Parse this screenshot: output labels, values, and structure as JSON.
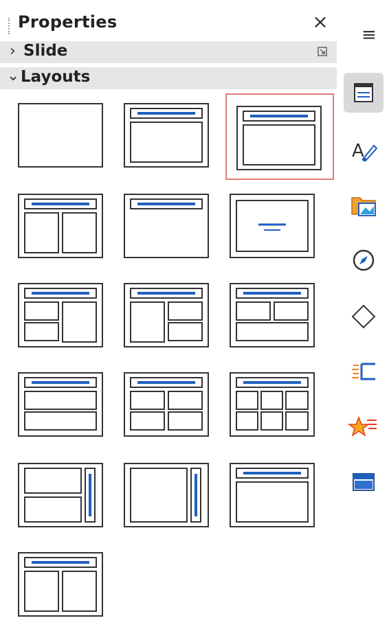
{
  "panel": {
    "title": "Properties",
    "close_glyph": "×",
    "sections": [
      {
        "label": "Slide",
        "expanded": false
      },
      {
        "label": "Layouts",
        "expanded": true
      }
    ]
  },
  "deck": {
    "menu_glyph": "≡",
    "icons": [
      "properties-icon",
      "styles-icon",
      "gallery-icon",
      "navigator-icon",
      "shapes-icon",
      "animation-icon",
      "slide-transition-icon",
      "master-slides-icon"
    ],
    "active": "properties-icon"
  },
  "layouts": {
    "selected_index": 2,
    "items": [
      "blank",
      "title-content",
      "title-content",
      "title-2-content",
      "title-only",
      "centered-text",
      "title-2-content-left",
      "title-2-content-right",
      "title-content-2",
      "title-content-over",
      "title-4-content",
      "title-6-content",
      "vertical-title-text",
      "vertical-text",
      "title-content-plain",
      "title-2-content-alt"
    ]
  },
  "colors": {
    "accent": "#1f5fbf",
    "selection": "#e07a70",
    "header_bg": "#e6e6e6",
    "outline": "#333333"
  }
}
